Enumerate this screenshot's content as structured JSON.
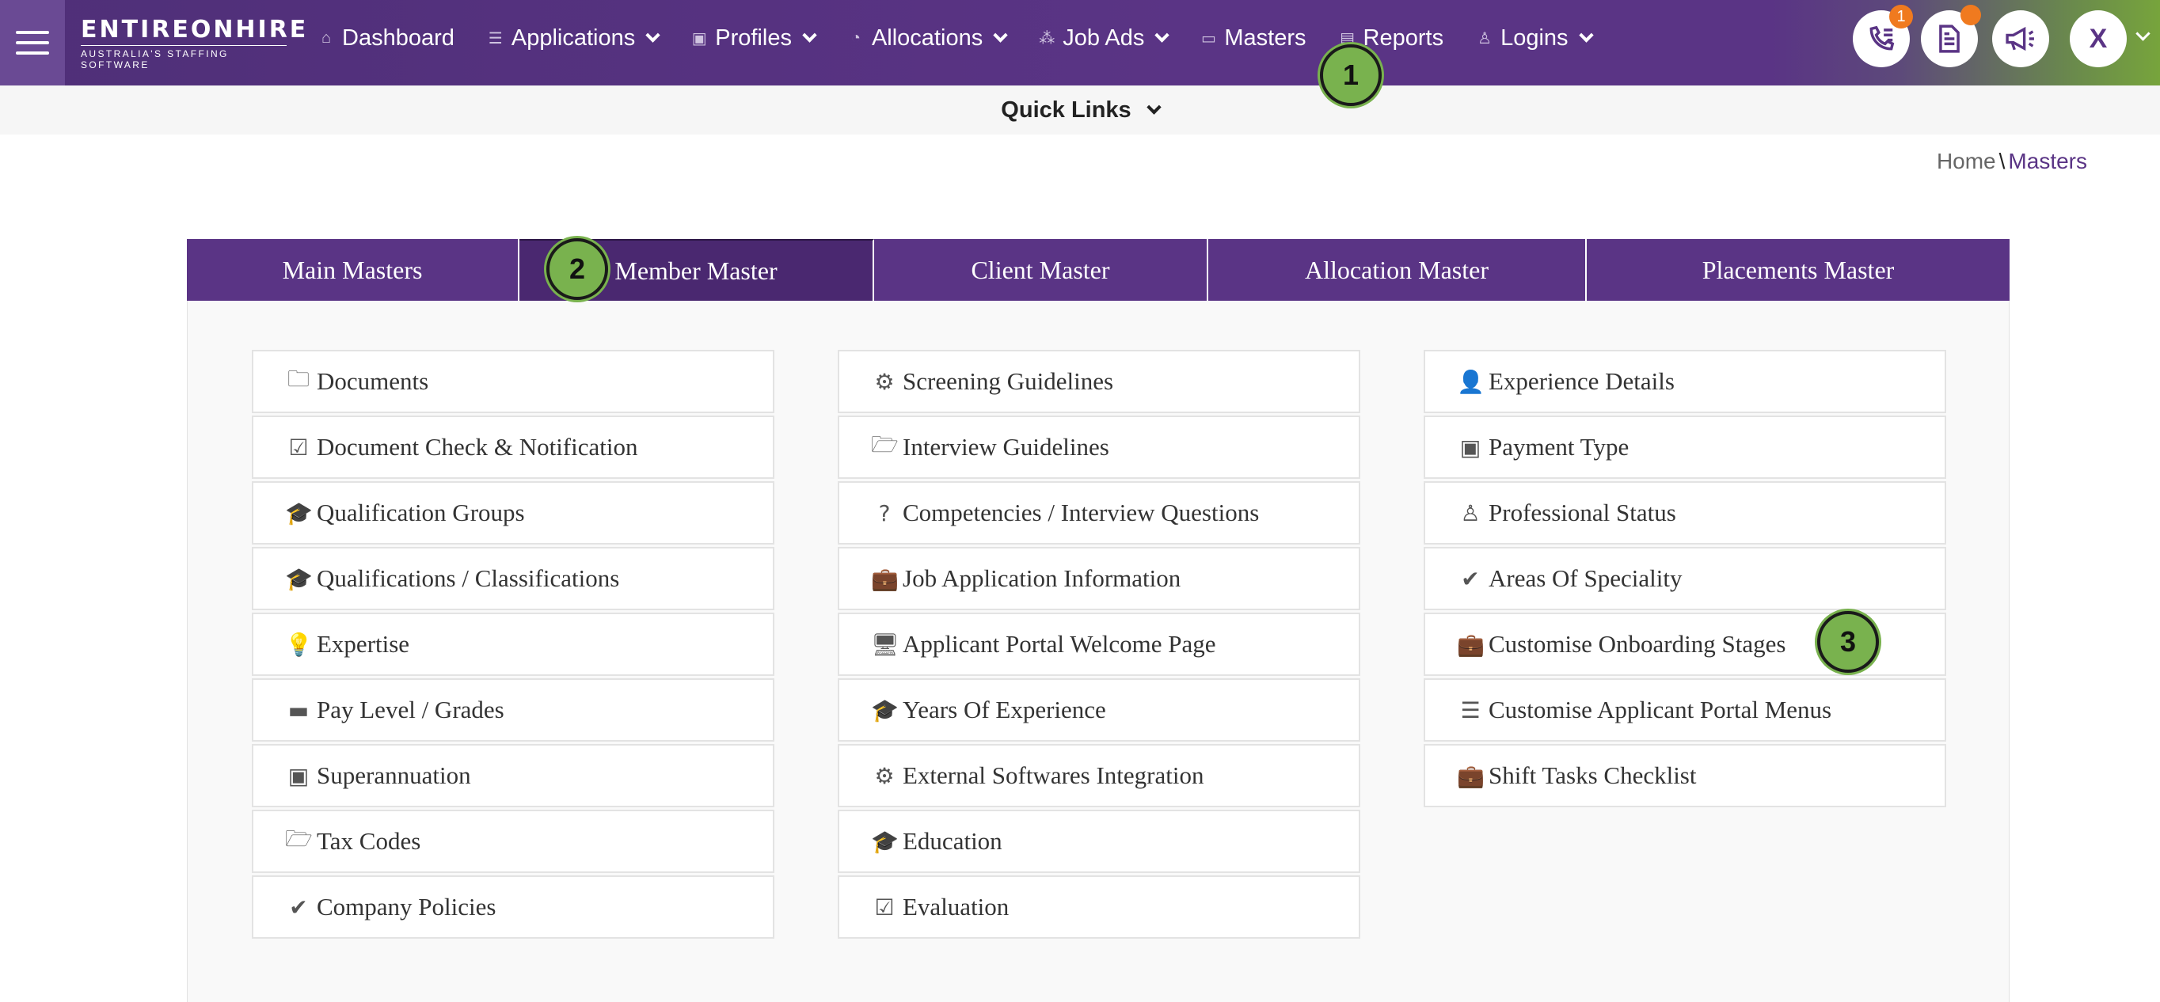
{
  "brand": {
    "name": "ENTIREONHIRE",
    "tagline": "AUSTRALIA'S STAFFING SOFTWARE"
  },
  "nav": [
    {
      "icon": "home-icon",
      "glyph": "⌂",
      "label": "Dashboard",
      "dropdown": false
    },
    {
      "icon": "list-icon",
      "glyph": "☰",
      "label": "Applications",
      "dropdown": true
    },
    {
      "icon": "profile-icon",
      "glyph": "▣",
      "label": "Profiles",
      "dropdown": true
    },
    {
      "icon": "pie-icon",
      "glyph": "◔",
      "label": "Allocations",
      "dropdown": true
    },
    {
      "icon": "network-icon",
      "glyph": "⁂",
      "label": "Job Ads",
      "dropdown": true
    },
    {
      "icon": "folder-icon",
      "glyph": "▭",
      "label": "Masters",
      "dropdown": false
    },
    {
      "icon": "report-icon",
      "glyph": "▤",
      "label": "Reports",
      "dropdown": false
    },
    {
      "icon": "user-icon",
      "glyph": "♙",
      "label": "Logins",
      "dropdown": true
    }
  ],
  "header_actions": {
    "phone_badge": "1",
    "avatar_letter": "X"
  },
  "quick_links": {
    "label": "Quick Links"
  },
  "breadcrumb": {
    "home": "Home",
    "separator": "\\",
    "current": "Masters"
  },
  "tabs": [
    {
      "label": "Main Masters",
      "active": false
    },
    {
      "label": "Member Master",
      "active": true
    },
    {
      "label": "Client Master",
      "active": false
    },
    {
      "label": "Allocation Master",
      "active": false
    },
    {
      "label": "Placements Master",
      "active": false
    }
  ],
  "columns": [
    [
      {
        "icon": "folder-icon",
        "glyph": "🗀",
        "label": "Documents"
      },
      {
        "icon": "checkbox-icon",
        "glyph": "☑",
        "label": "Document Check & Notification"
      },
      {
        "icon": "graduation-cap-icon",
        "glyph": "🎓",
        "label": "Qualification Groups"
      },
      {
        "icon": "graduation-cap-icon",
        "glyph": "🎓",
        "label": "Qualifications / Classifications"
      },
      {
        "icon": "lightbulb-icon",
        "glyph": "💡",
        "label": "Expertise"
      },
      {
        "icon": "credit-card-icon",
        "glyph": "▬",
        "label": "Pay Level / Grades"
      },
      {
        "icon": "money-icon",
        "glyph": "▣",
        "label": "Superannuation"
      },
      {
        "icon": "folder-open-icon",
        "glyph": "🗁",
        "label": "Tax Codes"
      },
      {
        "icon": "check-circle-icon",
        "glyph": "✔",
        "label": "Company Policies"
      }
    ],
    [
      {
        "icon": "gears-icon",
        "glyph": "⚙",
        "label": "Screening Guidelines"
      },
      {
        "icon": "folder-open-icon",
        "glyph": "🗁",
        "label": "Interview Guidelines"
      },
      {
        "icon": "question-circle-icon",
        "glyph": "?",
        "label": "Competencies / Interview Questions"
      },
      {
        "icon": "briefcase-icon",
        "glyph": "💼",
        "label": "Job Application Information"
      },
      {
        "icon": "desktop-icon",
        "glyph": "🖥",
        "label": "Applicant Portal Welcome Page"
      },
      {
        "icon": "graduation-cap-icon",
        "glyph": "🎓",
        "label": "Years Of Experience"
      },
      {
        "icon": "gear-icon",
        "glyph": "⚙",
        "label": "External Softwares Integration"
      },
      {
        "icon": "graduation-cap-icon",
        "glyph": "🎓",
        "label": "Education"
      },
      {
        "icon": "check-square-icon",
        "glyph": "☑",
        "label": "Evaluation"
      }
    ],
    [
      {
        "icon": "user-icon",
        "glyph": "👤",
        "label": "Experience Details"
      },
      {
        "icon": "money-icon",
        "glyph": "▣",
        "label": "Payment Type"
      },
      {
        "icon": "user-outline-icon",
        "glyph": "♙",
        "label": "Professional Status"
      },
      {
        "icon": "check-icon",
        "glyph": "✔",
        "label": "Areas Of Speciality"
      },
      {
        "icon": "briefcase-icon",
        "glyph": "💼",
        "label": "Customise Onboarding Stages"
      },
      {
        "icon": "bars-icon",
        "glyph": "☰",
        "label": "Customise Applicant Portal Menus"
      },
      {
        "icon": "briefcase-icon",
        "glyph": "💼",
        "label": "Shift Tasks Checklist"
      }
    ]
  ],
  "step_markers": [
    "1",
    "2",
    "3"
  ],
  "colors": {
    "brand_purple": "#5a3485",
    "active_tab": "#4a2870",
    "marker_green": "#79b24e",
    "badge_orange": "#f07a1f"
  }
}
